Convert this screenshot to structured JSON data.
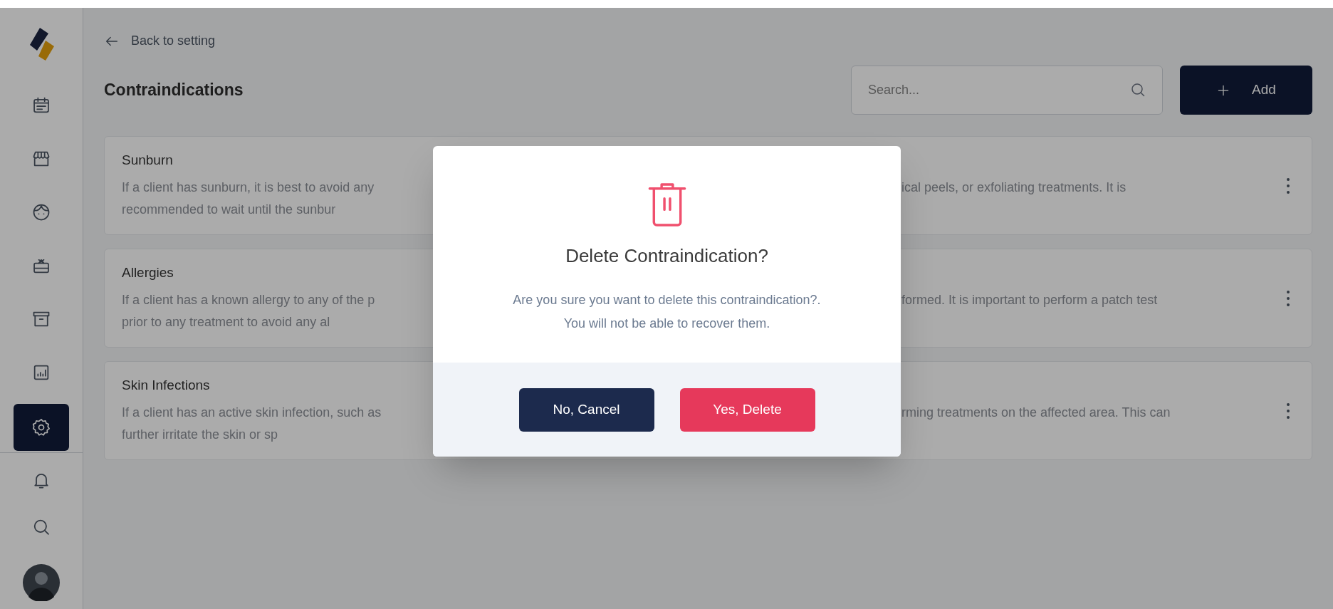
{
  "sidebar": {
    "items": [
      {
        "selected": false
      },
      {
        "selected": false
      },
      {
        "selected": false
      },
      {
        "selected": false
      },
      {
        "selected": false
      },
      {
        "selected": false
      },
      {
        "selected": true
      }
    ]
  },
  "back_link": "Back to setting",
  "title": "Contraindications",
  "search": {
    "placeholder": "Search..."
  },
  "add_button": "Add",
  "cards": [
    {
      "title": "Sunburn",
      "lines": [
        {
          "left": "If a client has sunburn, it is best to avoid any",
          "right": "ical peels, or exfoliating treatments. It is"
        },
        {
          "left": "recommended to wait until the sunbur"
        }
      ]
    },
    {
      "title": "Allergies",
      "lines": [
        {
          "left": "If a client has a known allergy to any of the p",
          "right": "formed. It is important to perform a patch test"
        },
        {
          "left": "prior to any treatment to avoid any al"
        }
      ]
    },
    {
      "title": "Skin Infections",
      "lines": [
        {
          "left": "If a client has an active skin infection, such as",
          "right": "rming treatments on the affected area. This can"
        },
        {
          "left": "further irritate the skin or sp"
        }
      ]
    }
  ],
  "dialog": {
    "title": "Delete Contraindication?",
    "message_lines": [
      "Are you sure you want to delete this contraindication?.",
      "You will not be able to recover them."
    ],
    "buttons": [
      {
        "label": "No, Cancel",
        "kind": "cancel"
      },
      {
        "label": "Yes, Delete",
        "kind": "danger"
      }
    ]
  }
}
